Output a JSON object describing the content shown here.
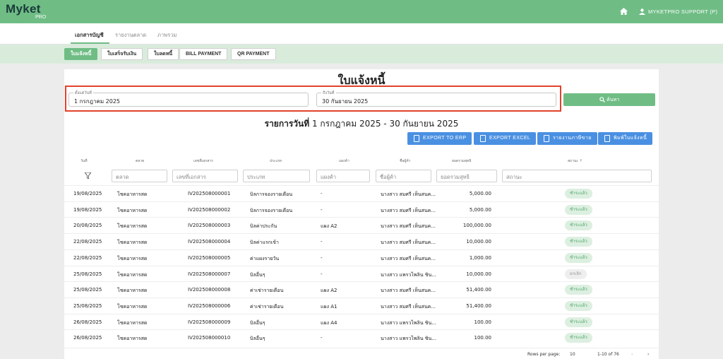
{
  "app": {
    "logo": "Myket",
    "logo_sub": "PRO",
    "user": "MYKETPRO SUPPORT (P)"
  },
  "tabs": [
    "เอกสารบัญชี",
    "รายงานตลาด",
    "ภาพรวม"
  ],
  "subtabs": [
    "ใบแจ้งหนี้",
    "ใบเสร็จรับเงิน",
    "ใบลดหนี้",
    "BILL PAYMENT",
    "QR PAYMENT"
  ],
  "page": {
    "title": "ใบแจ้งหนี้",
    "from_label": "ตั้งแต่วันที่",
    "from_value": "1 กรกฎาคม 2025",
    "to_label": "ถึงวันที่",
    "to_value": "30 กันยายน 2025",
    "search": "ค้นหา",
    "range_prefix": "รายการวันที่",
    "range_text": "1 กรกฎาคม 2025 - 30 กันยายน 2025"
  },
  "actions": [
    "EXPORT TO ERP",
    "EXPORT EXCEL",
    "รายงานภาษีขาย",
    "พิมพ์ใบแจ้งหนี้"
  ],
  "columns": [
    "วันที่",
    "ตลาด",
    "เลขที่เอกสาร",
    "ประเภท",
    "แผงค้า",
    "ชื่อผู้ค้า",
    "ยอดรวมสุทธิ",
    "สถานะ ↑"
  ],
  "filters": [
    "ตลาด",
    "เลขที่เอกสาร",
    "ประเภท",
    "แผงค้า",
    "ชื่อผู้ค้า",
    "ยอดรวมสุทธิ",
    "สถานะ"
  ],
  "rows": [
    {
      "date": "19/08/2025",
      "market": "โชคอาหารสด",
      "doc": "IV202508000001",
      "type": "บิลการจองรายเดือน",
      "stall": "-",
      "vendor": "นางสาว สมศรี เห็นสนค...",
      "amount": "5,000.00",
      "status": "ชำระแล้ว"
    },
    {
      "date": "19/08/2025",
      "market": "โชคอาหารสด",
      "doc": "IV202508000002",
      "type": "บิลการจองรายเดือน",
      "stall": "-",
      "vendor": "นางสาว สมศรี เห็นสนค...",
      "amount": "5,000.00",
      "status": "ชำระแล้ว"
    },
    {
      "date": "20/08/2025",
      "market": "โชคอาหารสด",
      "doc": "IV202508000003",
      "type": "บิลค่าประกัน",
      "stall": "แผง A2",
      "vendor": "นางสาว สมศรี เห็นสนค...",
      "amount": "100,000.00",
      "status": "ชำระแล้ว"
    },
    {
      "date": "22/08/2025",
      "market": "โชคอาหารสด",
      "doc": "IV202508000004",
      "type": "บิลค่าแรกเข้า",
      "stall": "-",
      "vendor": "นางสาว สมศรี เห็นสนค...",
      "amount": "10,000.00",
      "status": "ชำระแล้ว"
    },
    {
      "date": "22/08/2025",
      "market": "โชคอาหารสด",
      "doc": "IV202508000005",
      "type": "ค่าแผงรายวัน",
      "stall": "-",
      "vendor": "นางสาว สมศรี เห็นสนค...",
      "amount": "1,000.00",
      "status": "ชำระแล้ว"
    },
    {
      "date": "25/08/2025",
      "market": "โชคอาหารสด",
      "doc": "IV202508000007",
      "type": "บิลอื่นๆ",
      "stall": "-",
      "vendor": "นางสาว แพรวไพลิน ชิน...",
      "amount": "10,000.00",
      "status": "ยกเลิก"
    },
    {
      "date": "25/08/2025",
      "market": "โชคอาหารสด",
      "doc": "IV202508000008",
      "type": "ค่าเช่ารายเดือน",
      "stall": "แผง A2",
      "vendor": "นางสาว สมศรี เห็นสนค...",
      "amount": "51,400.00",
      "status": "ชำระแล้ว"
    },
    {
      "date": "25/08/2025",
      "market": "โชคอาหารสด",
      "doc": "IV202508000006",
      "type": "ค่าเช่ารายเดือน",
      "stall": "แผง A1",
      "vendor": "นางสาว สมศรี เห็นสนค...",
      "amount": "51,400.00",
      "status": "ชำระแล้ว"
    },
    {
      "date": "26/08/2025",
      "market": "โชคอาหารสด",
      "doc": "IV202508000009",
      "type": "บิลอื่นๆ",
      "stall": "แผง A4",
      "vendor": "นางสาว แพรวไพลิน ชิน...",
      "amount": "100.00",
      "status": "ชำระแล้ว"
    },
    {
      "date": "26/08/2025",
      "market": "โชคอาหารสด",
      "doc": "IV202508000010",
      "type": "บิลอื่นๆ",
      "stall": "-",
      "vendor": "นางสาว แพรวไพลิน ชิน...",
      "amount": "100.00",
      "status": "ชำระแล้ว"
    }
  ],
  "pagination": {
    "rows_label": "Rows per page:",
    "rows_value": "10",
    "range": "1-10 of 76"
  },
  "colors": {
    "primary": "#6fbd85",
    "accent": "#4a90e2",
    "highlight": "#e2422b"
  }
}
